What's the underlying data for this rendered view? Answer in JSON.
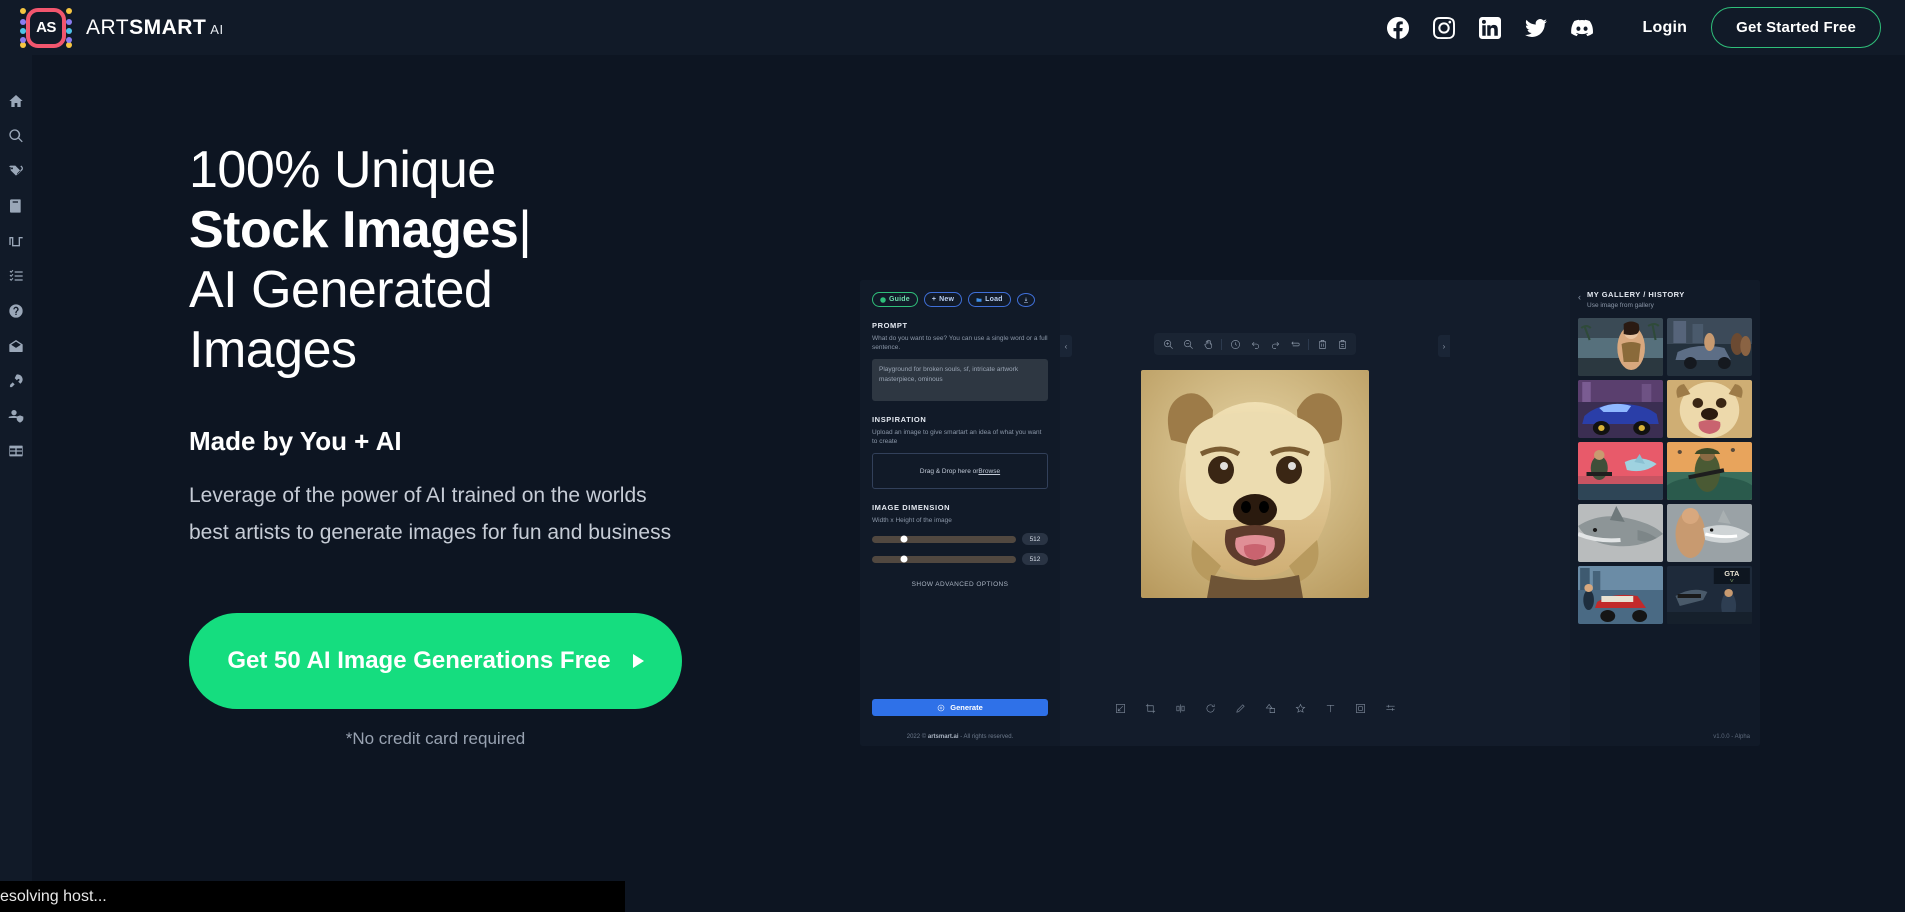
{
  "header": {
    "logo_text": "AS",
    "brand_part1": "ART",
    "brand_part2": "SMART",
    "brand_suffix": "AI",
    "socials": [
      {
        "name": "facebook-icon",
        "label": "Facebook"
      },
      {
        "name": "instagram-icon",
        "label": "Instagram"
      },
      {
        "name": "linkedin-icon",
        "label": "LinkedIn"
      },
      {
        "name": "twitter-icon",
        "label": "Twitter"
      },
      {
        "name": "discord-icon",
        "label": "Discord"
      }
    ],
    "login_label": "Login",
    "cta_label": "Get Started Free"
  },
  "sidebar": {
    "items": [
      {
        "icon": "home-icon",
        "label": "Home"
      },
      {
        "icon": "search-icon",
        "label": "Search"
      },
      {
        "icon": "tags-icon",
        "label": "Tags"
      },
      {
        "icon": "book-icon",
        "label": "Guide"
      },
      {
        "icon": "wave-icon",
        "label": "Transitions"
      },
      {
        "icon": "checklist-icon",
        "label": "Checklist"
      },
      {
        "icon": "question-circle-icon",
        "label": "Help"
      },
      {
        "icon": "envelope-open-icon",
        "label": "Inbox"
      },
      {
        "icon": "rocket-icon",
        "label": "Launch"
      },
      {
        "icon": "user-shield-icon",
        "label": "Account"
      },
      {
        "icon": "table-icon",
        "label": "Table"
      }
    ]
  },
  "hero": {
    "line1": "100% Unique",
    "line2": "Stock Images",
    "caret": "|",
    "line3_a": "AI Generated",
    "line3_b": "Images",
    "subhead": "Made by You + AI",
    "paragraph": "Leverage of the power of AI trained on the worlds best artists to generate images for fun and business",
    "cta_label": "Get 50 AI Image Generations Free",
    "note": "*No credit card required"
  },
  "app": {
    "pills": [
      {
        "name": "guide-pill",
        "label": "Guide"
      },
      {
        "name": "new-pill",
        "label": "New"
      },
      {
        "name": "load-pill",
        "label": "Load"
      },
      {
        "name": "download-pill",
        "label": ""
      }
    ],
    "prompt": {
      "title": "PROMPT",
      "description": "What do you want to see? You can use a single word or a full sentence.",
      "value": "Playground for broken souls, sf, intricate artwork masterpiece, ominous"
    },
    "inspiration": {
      "title": "INSPIRATION",
      "description": "Upload an image to give smartart an idea of what you want to create",
      "drop_prefix": "Drag & Drop here or ",
      "drop_link": "Browse"
    },
    "dimension": {
      "title": "IMAGE DIMENSION",
      "description": "Width x Height of the image",
      "width_value": "512",
      "height_value": "512",
      "width_percent": 22,
      "height_percent": 22
    },
    "advanced_label": "SHOW ADVANCED OPTIONS",
    "generate_label": "Generate",
    "copyright_pre": "2022 © ",
    "copyright_brand": "artsmart.ai",
    "copyright_post": " - All rights reserved.",
    "top_tools": [
      {
        "name": "zoom-in-icon"
      },
      {
        "name": "zoom-out-icon"
      },
      {
        "name": "hand-pan-icon"
      },
      {
        "name": "history-clock-icon"
      },
      {
        "name": "undo-icon"
      },
      {
        "name": "redo-icon"
      },
      {
        "name": "reset-loop-icon"
      },
      {
        "name": "delete-icon"
      },
      {
        "name": "delete-all-icon"
      }
    ],
    "bottom_tools": [
      {
        "name": "resize-icon"
      },
      {
        "name": "crop-icon"
      },
      {
        "name": "flip-icon"
      },
      {
        "name": "rotate-icon"
      },
      {
        "name": "pencil-icon"
      },
      {
        "name": "shapes-icon"
      },
      {
        "name": "star-icon"
      },
      {
        "name": "text-icon"
      },
      {
        "name": "frame-icon"
      },
      {
        "name": "adjust-sliders-icon"
      }
    ],
    "gallery": {
      "title": "MY GALLERY / HISTORY",
      "subtitle": "Use image from gallery",
      "thumbs": [
        {
          "name": "gallery-thumb-woman-palms"
        },
        {
          "name": "gallery-thumb-street-gang"
        },
        {
          "name": "gallery-thumb-sports-car"
        },
        {
          "name": "gallery-thumb-dog-portrait"
        },
        {
          "name": "gallery-thumb-shark-beach"
        },
        {
          "name": "gallery-thumb-soldier-sunset"
        },
        {
          "name": "gallery-thumb-shark-closeup"
        },
        {
          "name": "gallery-thumb-man-shark"
        },
        {
          "name": "gallery-thumb-city-car"
        },
        {
          "name": "gallery-thumb-gta-cover"
        }
      ]
    },
    "version": "v1.0.0 - Alpha"
  },
  "status_bar": {
    "text": "esolving host..."
  }
}
